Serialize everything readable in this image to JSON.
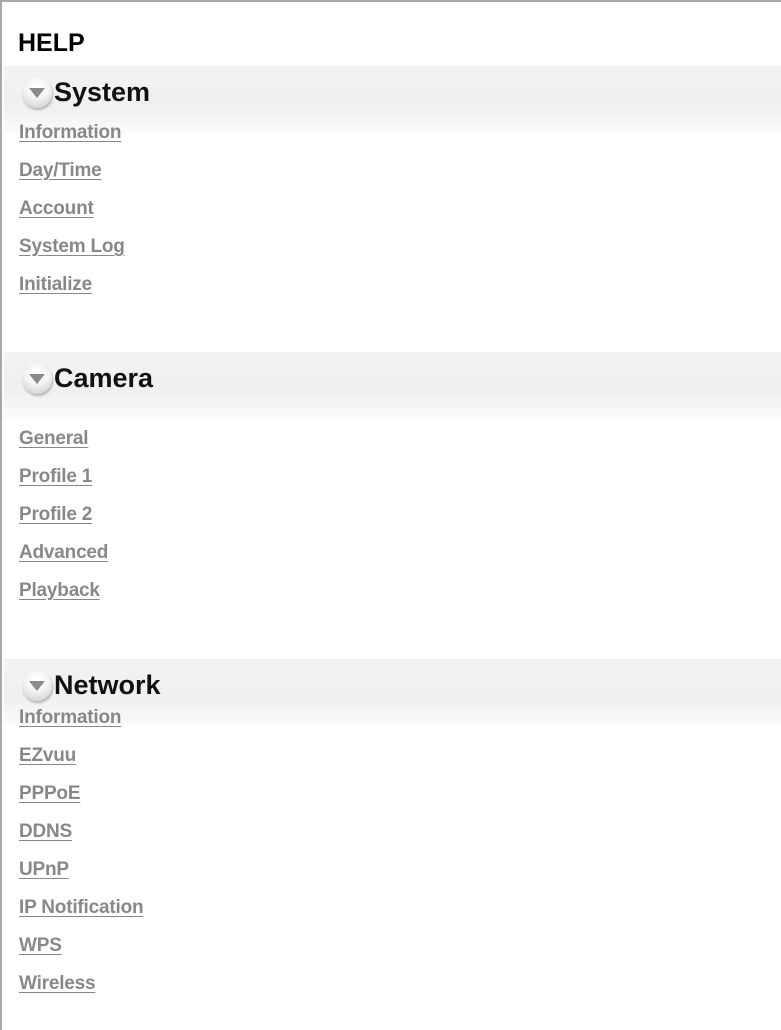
{
  "help": {
    "title": "HELP"
  },
  "sections": [
    {
      "title": "System",
      "icon": "collapse-arrow-icon",
      "links": [
        "Information",
        "Day/Time",
        "Account",
        "System Log",
        "Initialize"
      ]
    },
    {
      "title": "Camera",
      "icon": "collapse-arrow-icon",
      "links": [
        "General",
        "Profile 1",
        "Profile 2",
        "Advanced",
        "Playback"
      ]
    },
    {
      "title": "Network",
      "icon": "collapse-arrow-icon",
      "links": [
        "Information",
        "EZvuu",
        "PPPoE",
        "DDNS",
        "UPnP",
        "IP Notification",
        "WPS",
        "Wireless"
      ]
    }
  ],
  "colors": {
    "link": "#888888",
    "header_bg": "#f2f2f2",
    "frame_border": "#a8a8a8"
  }
}
